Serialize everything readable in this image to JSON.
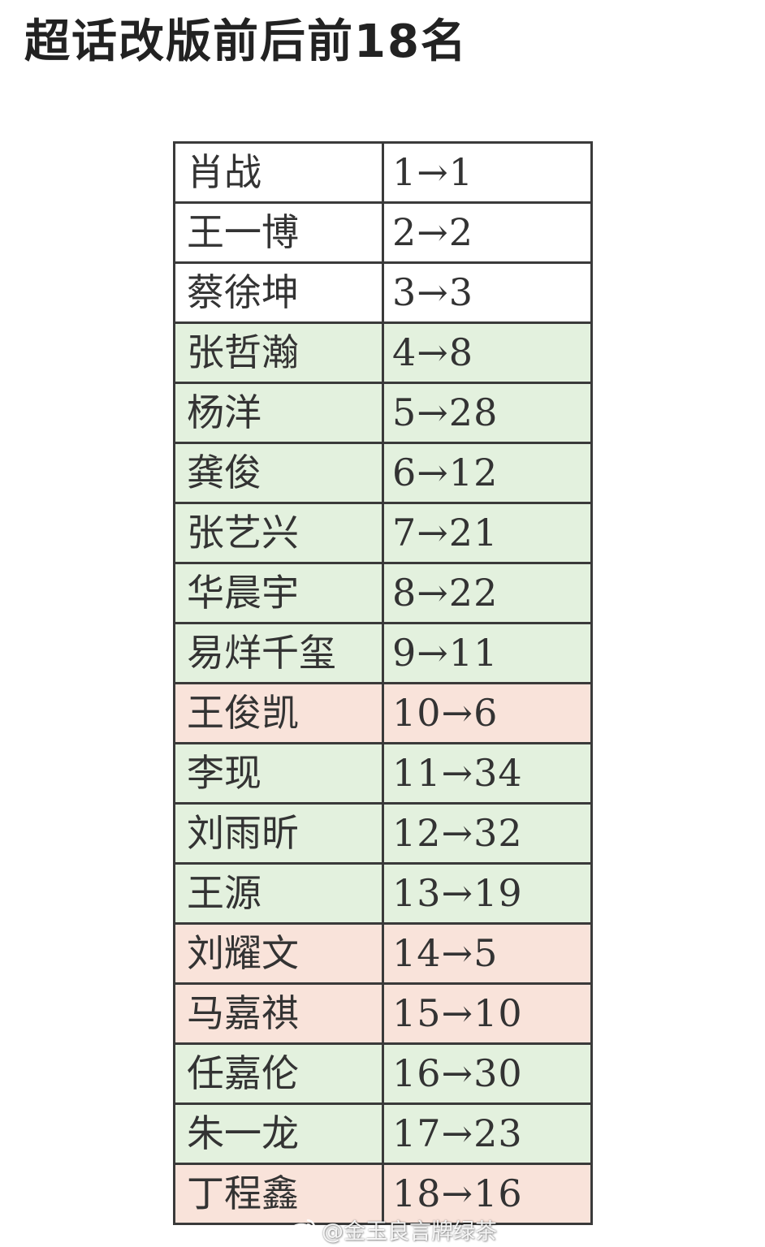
{
  "title": "超话改版前后前18名",
  "colors": {
    "unchanged": "#ffffff",
    "dropped": "#e3f1de",
    "rose": "#f9e3da",
    "border": "#3a3a3a"
  },
  "rows": [
    {
      "name": "肖战",
      "change": "1→1",
      "status": "unchanged"
    },
    {
      "name": "王一博",
      "change": "2→2",
      "status": "unchanged"
    },
    {
      "name": "蔡徐坤",
      "change": "3→3",
      "status": "unchanged"
    },
    {
      "name": "张哲瀚",
      "change": "4→8",
      "status": "dropped"
    },
    {
      "name": "杨洋",
      "change": "5→28",
      "status": "dropped"
    },
    {
      "name": "龚俊",
      "change": "6→12",
      "status": "dropped"
    },
    {
      "name": "张艺兴",
      "change": "7→21",
      "status": "dropped"
    },
    {
      "name": "华晨宇",
      "change": "8→22",
      "status": "dropped"
    },
    {
      "name": "易烊千玺",
      "change": "9→11",
      "status": "dropped"
    },
    {
      "name": "王俊凯",
      "change": "10→6",
      "status": "rose"
    },
    {
      "name": "李现",
      "change": "11→34",
      "status": "dropped"
    },
    {
      "name": "刘雨昕",
      "change": "12→32",
      "status": "dropped"
    },
    {
      "name": "王源",
      "change": "13→19",
      "status": "dropped"
    },
    {
      "name": "刘耀文",
      "change": "14→5",
      "status": "rose"
    },
    {
      "name": "马嘉祺",
      "change": "15→10",
      "status": "rose"
    },
    {
      "name": "任嘉伦",
      "change": "16→30",
      "status": "dropped"
    },
    {
      "name": "朱一龙",
      "change": "17→23",
      "status": "dropped"
    },
    {
      "name": "丁程鑫",
      "change": "18→16",
      "status": "rose"
    }
  ],
  "watermark": {
    "text": "@金玉良言牌绿茶",
    "icon": "weibo-icon"
  }
}
